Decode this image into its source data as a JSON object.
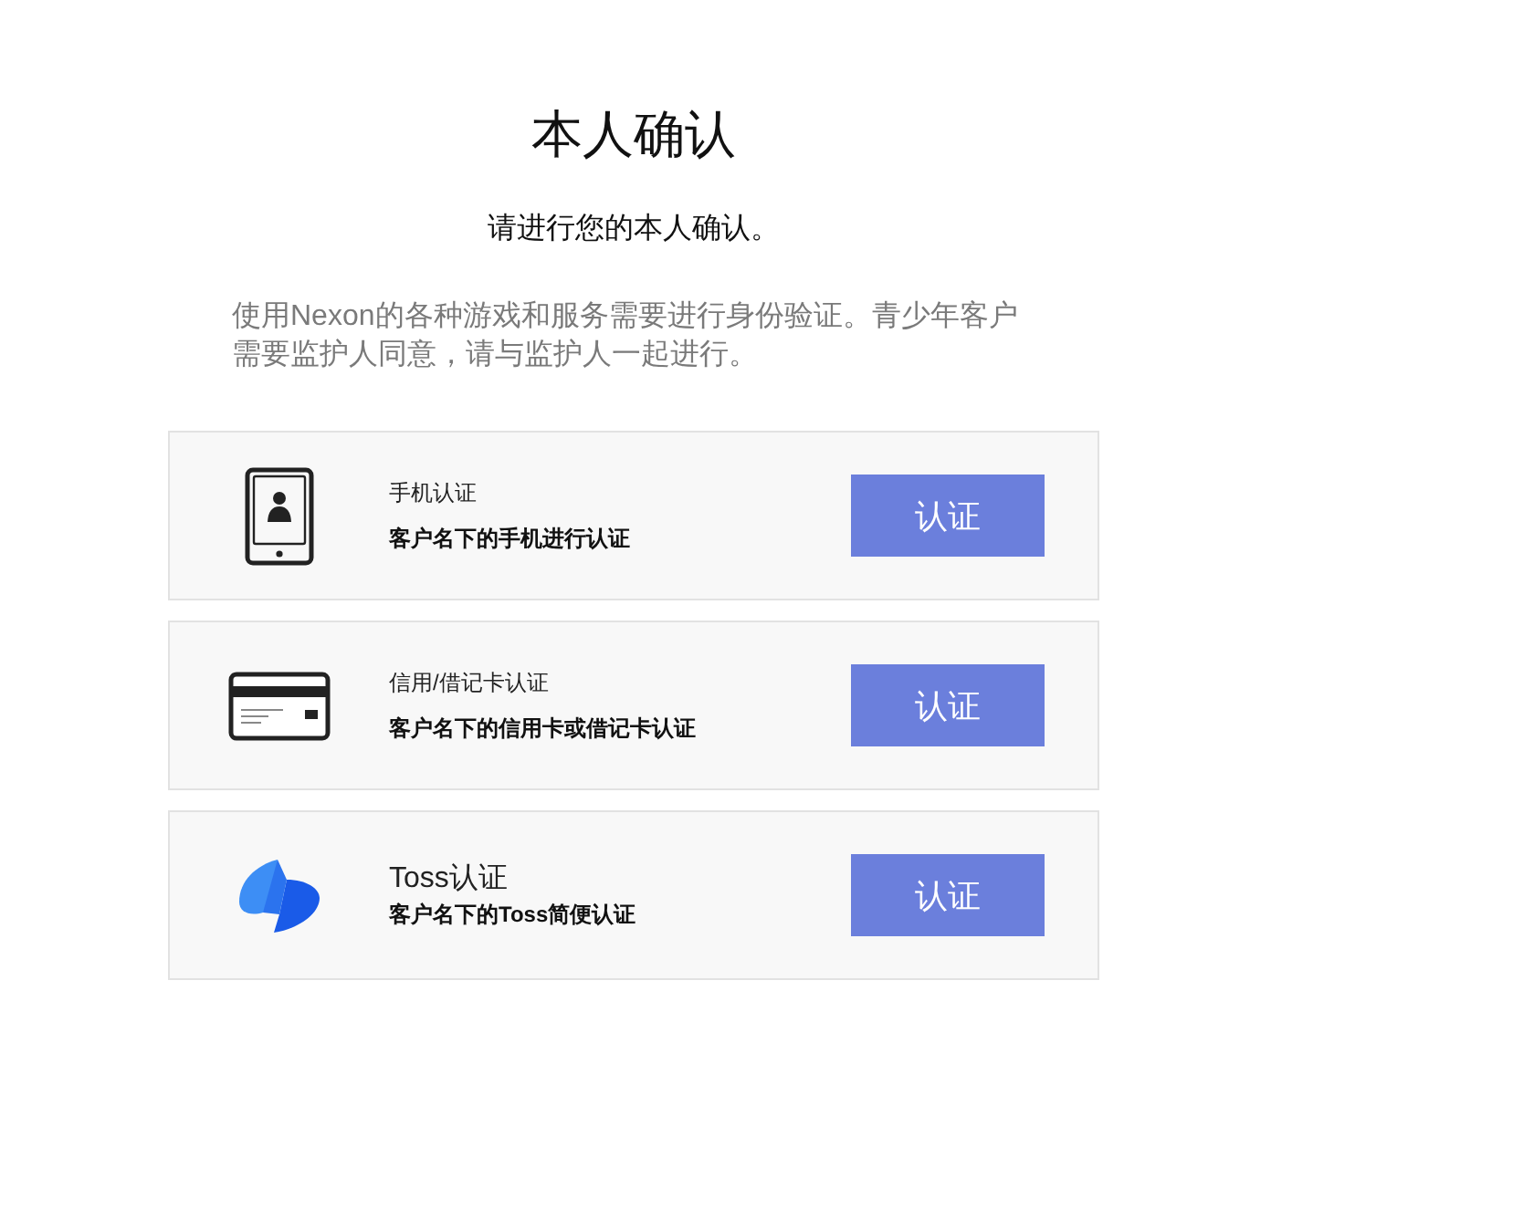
{
  "title": "本人确认",
  "subtitle": "请进行您的本人确认。",
  "description": "使用Nexon的各种游戏和服务需要进行身份验证。青少年客户需要监护人同意，请与监护人一起进行。",
  "methods": [
    {
      "kind": "phone",
      "title": "手机认证",
      "detail": "客户名下的手机进行认证",
      "button": "认证"
    },
    {
      "kind": "card",
      "title": "信用/借记卡认证",
      "detail": "客户名下的信用卡或借记卡认证",
      "button": "认证"
    },
    {
      "kind": "toss",
      "title": "Toss认证",
      "detail": "客户名下的Toss简便认证",
      "button": "认证"
    }
  ]
}
